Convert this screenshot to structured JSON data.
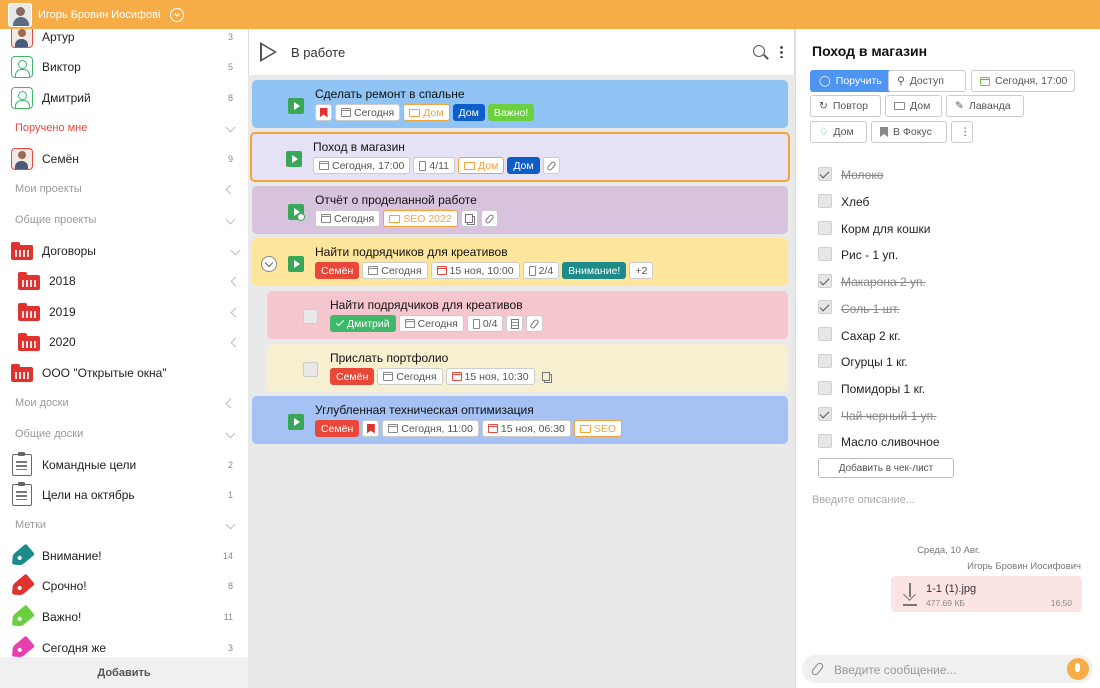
{
  "topbar": {
    "user_name": "Игорь Бровин Иосифовi"
  },
  "sidebar": {
    "users": [
      {
        "name": "Артур",
        "count": "3"
      },
      {
        "name": "Виктор",
        "count": "5"
      },
      {
        "name": "Дмитрий",
        "count": "8"
      }
    ],
    "assigned_header": "Поручено мне",
    "assigned_user": {
      "name": "Семён",
      "count": "9"
    },
    "my_projects": "Мои проекты",
    "shared_projects": "Общие проекты",
    "projects": [
      {
        "name": "Договоры"
      },
      {
        "name": "2018"
      },
      {
        "name": "2019"
      },
      {
        "name": "2020"
      },
      {
        "name": "ООО \"Открытые окна\""
      }
    ],
    "my_boards": "Мои доски",
    "shared_boards": "Общие доски",
    "boards": [
      {
        "name": "Командные цели",
        "count": "2"
      },
      {
        "name": "Цели на октябрь",
        "count": "1"
      }
    ],
    "tags_header": "Метки",
    "tags": [
      {
        "name": "Внимание!",
        "count": "14",
        "color": "#1e8b8b"
      },
      {
        "name": "Срочно!",
        "count": "8",
        "color": "#e0322e"
      },
      {
        "name": "Важно!",
        "count": "11",
        "color": "#6ccf3f"
      },
      {
        "name": "Сегодня же",
        "count": "3",
        "color": "#e83fb0"
      }
    ],
    "add_label": "Добавить"
  },
  "middle": {
    "title": "В работе",
    "tasks": [
      {
        "title": "Сделать ремонт в спальне",
        "color": "#8fc4f5",
        "chips": {
          "date": "Сегодня",
          "project": "Дом",
          "tag1": "Дом",
          "tag2": "Важно!"
        }
      },
      {
        "title": "Поход в магазин",
        "color": "#e6e2f5",
        "chips": {
          "date": "Сегодня, 17:00",
          "check": "4/11",
          "project": "Дом",
          "tag1": "Дом"
        }
      },
      {
        "title": "Отчёт о проделанной работе",
        "color": "#d7c3dd",
        "chips": {
          "date": "Сегодня",
          "project": "SEO 2022"
        }
      },
      {
        "title": "Найти подрядчиков для креативов",
        "color": "#fde59c",
        "chips": {
          "user": "Семён",
          "date": "Сегодня",
          "deadline": "15 ноя, 10:00",
          "check": "2/4",
          "tag": "Внимание!",
          "more": "+2"
        }
      },
      {
        "title": "Найти подрядчиков для креативов",
        "color": "#f6c6cf",
        "chips": {
          "user": "Дмитрий",
          "date": "Сегодня",
          "check": "0/4"
        }
      },
      {
        "title": "Прислать портфолио",
        "color": "#f6efd0",
        "chips": {
          "user": "Семён",
          "date": "Сегодня",
          "deadline": "15 ноя, 10:30"
        }
      },
      {
        "title": "Углубленная техническая оптимизация",
        "color": "#a6c2f5",
        "chips": {
          "user": "Семён",
          "date": "Сегодня, 11:00",
          "deadline": "15 ноя, 06:30",
          "project": "SEO"
        }
      }
    ]
  },
  "detail": {
    "title": "Поход в магазин",
    "buttons": {
      "assign": "Поручить",
      "access": "Доступ",
      "date": "Сегодня, 17:00",
      "repeat": "Повтор",
      "project": "Дом",
      "lavender": "Лаванда",
      "tag": "Дом",
      "focus": "В Фокус"
    },
    "checklist": [
      {
        "text": "Молоко",
        "done": true
      },
      {
        "text": "Хлеб",
        "done": false
      },
      {
        "text": "Корм для кошки",
        "done": false
      },
      {
        "text": "Рис - 1 уп.",
        "done": false
      },
      {
        "text": "Макарона 2 уп.",
        "done": true
      },
      {
        "text": "Соль 1 шт.",
        "done": true
      },
      {
        "text": "Сахар 2 кг.",
        "done": false
      },
      {
        "text": "Огурцы 1 кг.",
        "done": false
      },
      {
        "text": "Помидоры 1 кг.",
        "done": false
      },
      {
        "text": "Чай черный 1 уп.",
        "done": true
      },
      {
        "text": "Масло сливочное",
        "done": false
      }
    ],
    "add_checklist": "Добавить в чек-лист",
    "description_placeholder": "Введите описание...",
    "chat": {
      "date": "Среда, 10 Авг.",
      "author": "Игорь Бровин Иосифович",
      "file_name": "1-1 (1).jpg",
      "file_size": "477.69 КБ",
      "time": "16:50"
    },
    "message_placeholder": "Введите сообщение..."
  }
}
